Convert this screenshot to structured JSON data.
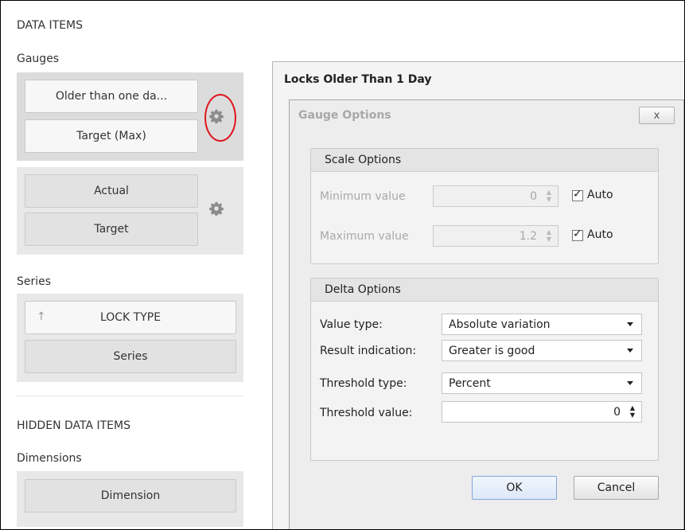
{
  "left_panel": {
    "data_items_label": "DATA ITEMS",
    "gauges_label": "Gauges",
    "gauge_group_1": {
      "item_1": "Older than one da...",
      "item_2": "Target (Max)"
    },
    "gauge_group_2": {
      "item_1": "Actual",
      "item_2": "Target"
    },
    "series_label": "Series",
    "series_items": {
      "item_1": "LOCK TYPE",
      "item_1_icon": "↑",
      "item_2": "Series"
    },
    "hidden_label": "HIDDEN DATA ITEMS",
    "dimensions_label": "Dimensions",
    "dimension_item": "Dimension"
  },
  "dashboard_panel": {
    "title": "Locks Older Than 1 Day"
  },
  "dialog": {
    "title": "Gauge Options",
    "close_label": "x",
    "scale_options": {
      "title": "Scale Options",
      "min_label": "Minimum value",
      "min_value": "0",
      "min_auto_label": "Auto",
      "min_auto_checked": true,
      "max_label": "Maximum value",
      "max_value": "1.2",
      "max_auto_label": "Auto",
      "max_auto_checked": true
    },
    "delta_options": {
      "title": "Delta Options",
      "value_type_label": "Value type:",
      "value_type_value": "Absolute variation",
      "result_label": "Result indication:",
      "result_value": "Greater is good",
      "threshold_type_label": "Threshold type:",
      "threshold_type_value": "Percent",
      "threshold_value_label": "Threshold value:",
      "threshold_value": "0"
    },
    "ok_label": "OK",
    "cancel_label": "Cancel"
  },
  "icons": {
    "gear": "gear-icon",
    "arrow": "sort-arrow-icon",
    "check": "checkmark-icon",
    "caret": "dropdown-caret-icon",
    "spin": "spin-arrows-icon"
  },
  "colors": {
    "highlight_ring": "#e0141c",
    "ok_border": "#7fa6d9"
  }
}
